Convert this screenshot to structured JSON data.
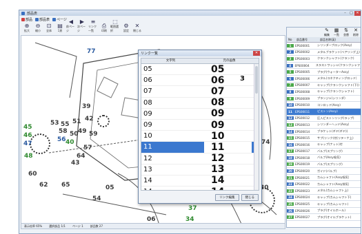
{
  "window": {
    "title": "部品表"
  },
  "topbar": [
    {
      "label": "部品",
      "color": "#d04040"
    },
    {
      "label": "部品表",
      "color": "#3a70c0"
    },
    {
      "label": "ページ",
      "color": "#3a70c0"
    }
  ],
  "toolbar": [
    {
      "icon": "zoom-in-icon",
      "glyph": "⊕",
      "label": "拡大"
    },
    {
      "icon": "zoom-out-icon",
      "glyph": "⊖",
      "label": "縮小"
    },
    {
      "icon": "fit-icon",
      "glyph": "⊡",
      "label": "全体"
    },
    {
      "icon": "page-icon",
      "glyph": "▤",
      "label": "1頁"
    },
    {
      "icon": "prev-icon",
      "glyph": "◀",
      "label": "前ページ"
    },
    {
      "icon": "next-icon",
      "glyph": "▶",
      "label": "次ページ"
    },
    {
      "icon": "list-icon",
      "glyph": "≡",
      "label": "リンク一覧"
    },
    {
      "icon": "print-icon",
      "glyph": "⎙",
      "label": "印刷"
    },
    {
      "icon": "select-icon",
      "glyph": "⬚",
      "label": "範囲選択"
    },
    {
      "icon": "setting-icon",
      "glyph": "⚙",
      "label": "設定"
    },
    {
      "icon": "close-icon",
      "glyph": "✕",
      "label": "閉じる"
    }
  ],
  "dialog": {
    "title": "リンク一覧",
    "col_number": "文字列",
    "col_image": "元の画像",
    "rows": [
      {
        "num": "05",
        "img": "05",
        "mark": ""
      },
      {
        "num": "06",
        "img": "06",
        "mark": "3"
      },
      {
        "num": "07",
        "img": "07",
        "mark": ""
      },
      {
        "num": "08",
        "img": "08",
        "mark": ""
      },
      {
        "num": "09",
        "img": "09",
        "mark": ""
      },
      {
        "num": "09",
        "img": "09",
        "mark": ""
      },
      {
        "num": "10",
        "img": "10",
        "mark": ""
      },
      {
        "num": "11",
        "img": "11",
        "mark": ""
      },
      {
        "num": "12",
        "img": "12",
        "mark": ""
      },
      {
        "num": "13",
        "img": "13",
        "mark": ""
      },
      {
        "num": "14",
        "img": "14",
        "mark": ""
      },
      {
        "num": "14",
        "img": "14",
        "mark": ""
      }
    ],
    "selected_index": 7,
    "btn_edit": "リンク編集",
    "btn_close": "閉じる"
  },
  "panel": {
    "col_no": "No",
    "col_code": "部品番号",
    "col_name": "部品名称(英)",
    "tools": [
      {
        "glyph": "✎",
        "label": "編集"
      },
      {
        "glyph": "▦",
        "label": "一覧"
      },
      {
        "glyph": "⇅",
        "label": "並替"
      },
      {
        "glyph": "✕",
        "label": "削除"
      }
    ],
    "rows": [
      {
        "no": "1",
        "code": "EPS00001",
        "name": "シリンダーブロック(Assy)",
        "color": "#4aa84a"
      },
      {
        "no": "2",
        "code": "EPS00002",
        "name": "メタルブラケット(ベアリング上)",
        "color": "#3a70c0"
      },
      {
        "no": "3",
        "code": "EPS00003",
        "name": "クランクシャフト(クランク)",
        "color": "#4aa84a"
      },
      {
        "no": "4",
        "code": "EPS00004",
        "name": "スラストワッシャ(クランクシャフト)",
        "color": "#3a70c0"
      },
      {
        "no": "5",
        "code": "EPS00005",
        "name": "プラグ(ウォーターAssy)",
        "color": "#4aa84a"
      },
      {
        "no": "6",
        "code": "EPS00006",
        "name": "メタル(コネクティングロッド)",
        "color": "#3a70c0"
      },
      {
        "no": "7",
        "code": "EPS00007",
        "name": "キャップ(クランクシャフト(下))",
        "color": "#4aa84a"
      },
      {
        "no": "8",
        "code": "EPS00008",
        "name": "キャップ(クランクシャフト)",
        "color": "#3a70c0"
      },
      {
        "no": "9",
        "code": "EPS00009",
        "name": "プランジャ(シリンダ)",
        "color": "#4aa84a"
      },
      {
        "no": "10",
        "code": "EPS00010",
        "name": "コンロッド(Assy)",
        "color": "#3a70c0"
      },
      {
        "no": "11",
        "code": "EPS00011",
        "name": "ピストン(Assy)",
        "color": "#3d7bd1"
      },
      {
        "no": "12",
        "code": "EPS00012",
        "name": "圧入ピストンリング(ラップ)",
        "color": "#3a70c0"
      },
      {
        "no": "13",
        "code": "EPS00013",
        "name": "シリンダーヘッド(Assy)",
        "color": "#4aa84a"
      },
      {
        "no": "14",
        "code": "EPS00014",
        "name": "ブラケット(ギヤ(ギヤ))",
        "color": "#3a70c0"
      },
      {
        "no": "15",
        "code": "EPS00015",
        "name": "サブ(リンク)付(リテーナ上)",
        "color": "#4aa84a"
      },
      {
        "no": "16",
        "code": "EPS00016",
        "name": "キャップ(ナット)付",
        "color": "#3a70c0"
      },
      {
        "no": "17",
        "code": "EPS00017",
        "name": "バルブ(スプリング)",
        "color": "#4aa84a"
      },
      {
        "no": "18",
        "code": "EPS00018",
        "name": "バルブ(Assy吸気)",
        "color": "#3a70c0"
      },
      {
        "no": "19",
        "code": "EPS00019",
        "name": "バルブ(スプリング)",
        "color": "#4aa84a"
      },
      {
        "no": "20",
        "code": "EPS00020",
        "name": "ガイド(バルブ)",
        "color": "#3a70c0"
      },
      {
        "no": "21",
        "code": "EPS00021",
        "name": "カムシャフト(Assy吸気)",
        "color": "#4aa84a"
      },
      {
        "no": "22",
        "code": "EPS00022",
        "name": "カムシャフト(Assy排気)",
        "color": "#3a70c0"
      },
      {
        "no": "23",
        "code": "EPS00023",
        "name": "メタル(カムシャフト上)",
        "color": "#4aa84a"
      },
      {
        "no": "24",
        "code": "EPS00024",
        "name": "キャップ(カムシャフト下)",
        "color": "#3a70c0"
      },
      {
        "no": "25",
        "code": "EPS00025",
        "name": "キャップ(カムシャフト)",
        "color": "#4aa84a"
      },
      {
        "no": "26",
        "code": "EPS00026",
        "name": "プラグ(オイルホール)",
        "color": "#3a70c0"
      },
      {
        "no": "27",
        "code": "EPS00027",
        "name": "プラグ(オイルブラケット)",
        "color": "#4aa84a"
      }
    ],
    "selected_index": 10
  },
  "drawing_labels": [
    {
      "text": "77",
      "color": "blue"
    },
    {
      "text": "39",
      "color": ""
    },
    {
      "text": "45",
      "color": "green"
    },
    {
      "text": "46",
      "color": "green"
    },
    {
      "text": "47",
      "color": "blue"
    },
    {
      "text": "48",
      "color": "green"
    },
    {
      "text": "53",
      "color": ""
    },
    {
      "text": "55",
      "color": ""
    },
    {
      "text": "51",
      "color": ""
    },
    {
      "text": "42",
      "color": ""
    },
    {
      "text": "58",
      "color": ""
    },
    {
      "text": "56",
      "color": "blue"
    },
    {
      "text": "50",
      "color": ""
    },
    {
      "text": "49",
      "color": ""
    },
    {
      "text": "59",
      "color": ""
    },
    {
      "text": "40",
      "color": "green"
    },
    {
      "text": "57",
      "color": ""
    },
    {
      "text": "64",
      "color": ""
    },
    {
      "text": "43",
      "color": ""
    },
    {
      "text": "60",
      "color": ""
    },
    {
      "text": "62",
      "color": ""
    },
    {
      "text": "65",
      "color": ""
    },
    {
      "text": "54",
      "color": ""
    },
    {
      "text": "05",
      "color": ""
    },
    {
      "text": "06",
      "color": ""
    },
    {
      "text": "34",
      "color": "green"
    },
    {
      "text": "37",
      "color": "green"
    },
    {
      "text": "30",
      "color": ""
    },
    {
      "text": "74",
      "color": ""
    }
  ],
  "statusbar": [
    "表示倍率 65%",
    "選択部品 1/1",
    "ページ 1",
    "部品数 27"
  ]
}
